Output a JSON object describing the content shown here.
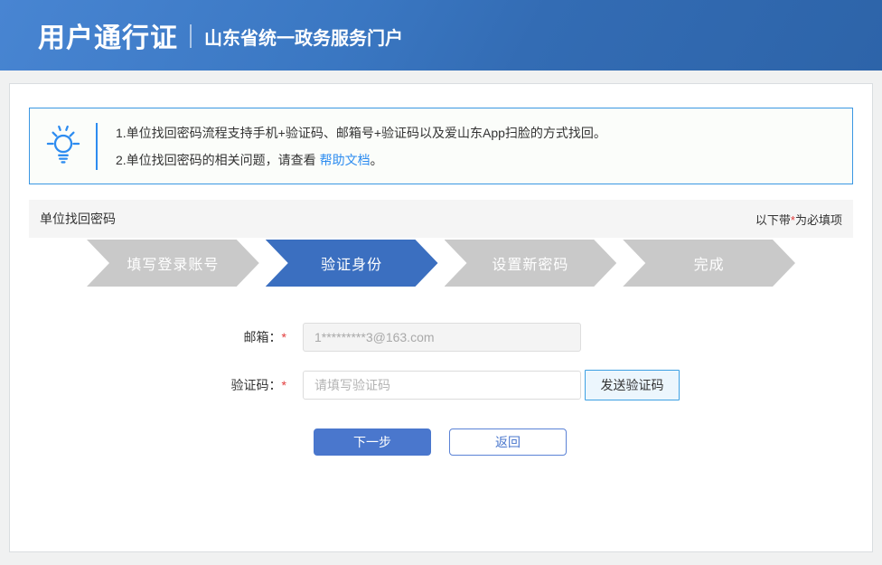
{
  "header": {
    "title": "用户通行证",
    "subtitle": "山东省统一政务服务门户"
  },
  "notice": {
    "line1": "1.单位找回密码流程支持手机+验证码、邮箱号+验证码以及爱山东App扫脸的方式找回。",
    "line2_prefix": "2.单位找回密码的相关问题，请查看 ",
    "line2_link": "帮助文档",
    "line2_suffix": "。"
  },
  "section": {
    "title": "单位找回密码",
    "required_prefix": "以下带",
    "required_star": "*",
    "required_suffix": "为必填项"
  },
  "steps": [
    {
      "label": "填写登录账号",
      "active": false
    },
    {
      "label": "验证身份",
      "active": true
    },
    {
      "label": "设置新密码",
      "active": false
    },
    {
      "label": "完成",
      "active": false
    }
  ],
  "form": {
    "email": {
      "label": "邮箱：",
      "required_star": "*",
      "value": "1*********3@163.com"
    },
    "code": {
      "label": "验证码：",
      "required_star": "*",
      "placeholder": "请填写验证码",
      "send_button": "发送验证码"
    },
    "next_button": "下一步",
    "back_button": "返回"
  },
  "colors": {
    "header_gradient_start": "#4885d2",
    "header_gradient_end": "#2d64a9",
    "accent_blue": "#2d8cf0",
    "notice_border": "#3a97e3",
    "step_gray": "#c9c9c9",
    "step_active_blue": "#3b6fc0",
    "primary_button_blue": "#4a77cd",
    "send_button_border": "#3da0e3",
    "send_button_bg": "#ecf6fd",
    "star_red": "#e23c3c"
  }
}
